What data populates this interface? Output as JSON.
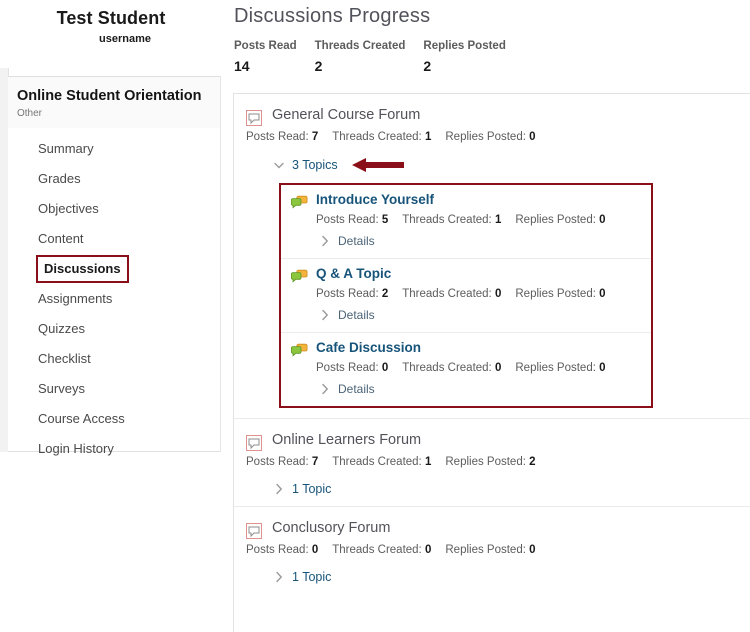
{
  "user": {
    "name": "Test Student",
    "handle": "username"
  },
  "course": {
    "title": "Online Student Orientation",
    "subtitle": "Other"
  },
  "sidebar": {
    "items": [
      {
        "label": "Summary",
        "selected": false
      },
      {
        "label": "Grades",
        "selected": false
      },
      {
        "label": "Objectives",
        "selected": false
      },
      {
        "label": "Content",
        "selected": false
      },
      {
        "label": "Discussions",
        "selected": true
      },
      {
        "label": "Assignments",
        "selected": false
      },
      {
        "label": "Quizzes",
        "selected": false
      },
      {
        "label": "Checklist",
        "selected": false
      },
      {
        "label": "Surveys",
        "selected": false
      },
      {
        "label": "Course Access",
        "selected": false
      },
      {
        "label": "Login History",
        "selected": false
      }
    ]
  },
  "main": {
    "title": "Discussions Progress",
    "summary_stats": [
      {
        "label": "Posts Read",
        "value": "14"
      },
      {
        "label": "Threads Created",
        "value": "2"
      },
      {
        "label": "Replies Posted",
        "value": "2"
      }
    ],
    "metric_labels": {
      "posts_read": "Posts Read:",
      "threads_created": "Threads Created:",
      "replies_posted": "Replies Posted:"
    },
    "details_label": "Details",
    "forums": [
      {
        "title": "General Course Forum",
        "icon": "forum-bubble-icon",
        "posts_read": "7",
        "threads_created": "1",
        "replies_posted": "0",
        "toggle_label": "3 Topics",
        "expanded": true,
        "has_arrow_annotation": true,
        "topics_highlighted": true,
        "topics": [
          {
            "title": "Introduce Yourself",
            "icon": "topic-bubbles-icon",
            "posts_read": "5",
            "threads_created": "1",
            "replies_posted": "0"
          },
          {
            "title": "Q & A Topic",
            "icon": "topic-bubbles-icon",
            "posts_read": "2",
            "threads_created": "0",
            "replies_posted": "0"
          },
          {
            "title": "Cafe Discussion",
            "icon": "topic-bubbles-icon",
            "posts_read": "0",
            "threads_created": "0",
            "replies_posted": "0"
          }
        ]
      },
      {
        "title": "Online Learners Forum",
        "icon": "forum-bubble-icon",
        "posts_read": "7",
        "threads_created": "1",
        "replies_posted": "2",
        "toggle_label": "1 Topic",
        "expanded": false,
        "has_arrow_annotation": false,
        "topics_highlighted": false,
        "topics": []
      },
      {
        "title": "Conclusory Forum",
        "icon": "forum-bubble-icon",
        "posts_read": "0",
        "threads_created": "0",
        "replies_posted": "0",
        "toggle_label": "1 Topic",
        "expanded": false,
        "has_arrow_annotation": false,
        "topics_highlighted": false,
        "topics": []
      }
    ]
  },
  "colors": {
    "highlight_red": "#8b0f18",
    "link_blue": "#17547a",
    "title_grey": "#52525b",
    "topic_icon_green": "#7cb342",
    "topic_icon_yellow": "#f5b942",
    "forum_icon_border": "#e0918f"
  }
}
